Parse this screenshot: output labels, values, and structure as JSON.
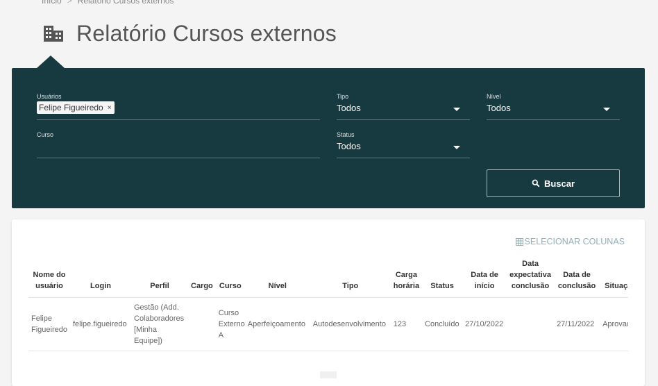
{
  "breadcrumb": {
    "home": "Início",
    "separator": ">",
    "current": "Relatório Cursos externos"
  },
  "page": {
    "title": "Relatório Cursos externos",
    "icon": "building-icon"
  },
  "filters": {
    "usuarios": {
      "label": "Usuários",
      "chip": "Felipe Figueiredo",
      "chip_remove": "×"
    },
    "tipo": {
      "label": "Tipo",
      "value": "Todos"
    },
    "nivel": {
      "label": "Nível",
      "value": "Todos"
    },
    "curso": {
      "label": "Curso",
      "value": ""
    },
    "status": {
      "label": "Status",
      "value": "Todos"
    },
    "search_button": "Buscar",
    "panel_color": "#173a40"
  },
  "results": {
    "select_columns": "SELECIONAR COLUNAS",
    "columns": [
      "Nome do usuário",
      "Login",
      "Perfil",
      "Cargo",
      "Curso",
      "Nível",
      "Tipo",
      "Carga horária",
      "Status",
      "Data de início",
      "Data expectativa conclusão",
      "Data de conclusão",
      "Situação"
    ],
    "rows": [
      [
        "Felipe Figueiredo",
        "felipe.figueiredo",
        "Gestão (Add. Colaboradores [Minha Equipe])",
        "",
        "Curso Externo A",
        "Aperfeiçoamento",
        "Autodesenvolvimento",
        "123",
        "Concluído",
        "27/10/2022",
        "",
        "27/11/2022",
        "Aprovado"
      ]
    ]
  }
}
